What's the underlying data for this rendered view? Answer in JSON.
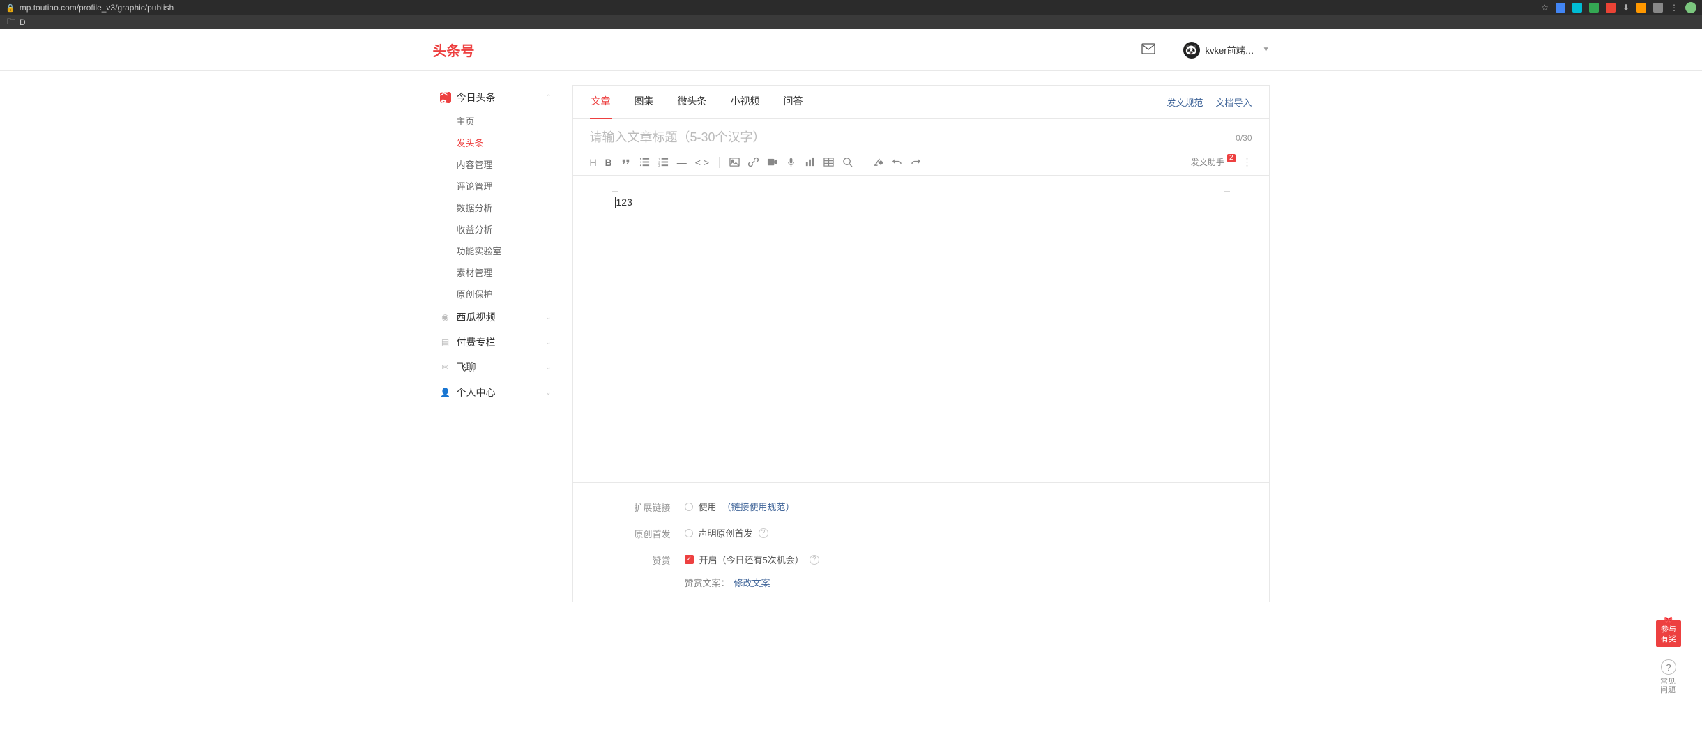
{
  "browser": {
    "url": "mp.toutiao.com/profile_v3/graphic/publish",
    "bookmark": "D"
  },
  "header": {
    "brand": "头条号",
    "user_name": "kvker前端…"
  },
  "sidebar": {
    "sections": [
      {
        "label": "今日头条",
        "expanded": true
      },
      {
        "label": "西瓜视频",
        "expanded": false
      },
      {
        "label": "付费专栏",
        "expanded": false
      },
      {
        "label": "飞聊",
        "expanded": false
      },
      {
        "label": "个人中心",
        "expanded": false
      }
    ],
    "sub_items": [
      "主页",
      "发头条",
      "内容管理",
      "评论管理",
      "数据分析",
      "收益分析",
      "功能实验室",
      "素材管理",
      "原创保护"
    ],
    "active_sub": "发头条"
  },
  "tabs": {
    "items": [
      "文章",
      "图集",
      "微头条",
      "小视频",
      "问答"
    ],
    "active": "文章",
    "links": [
      "发文规范",
      "文档导入"
    ]
  },
  "title": {
    "placeholder": "请输入文章标题（5-30个汉字）",
    "counter": "0/30"
  },
  "toolbar": {
    "helper_label": "发文助手",
    "helper_badge": "2"
  },
  "editor": {
    "content": "123"
  },
  "settings": {
    "ext_link": {
      "label": "扩展链接",
      "option": "使用",
      "hint": "（链接使用规范）"
    },
    "original": {
      "label": "原创首发",
      "option": "声明原创首发"
    },
    "reward": {
      "label": "赞赏",
      "option": "开启（今日还有5次机会）",
      "sub_label": "赞赏文案：",
      "sub_link": "修改文案"
    }
  },
  "float": {
    "promo": "参与有奖",
    "faq": "常见问题"
  }
}
